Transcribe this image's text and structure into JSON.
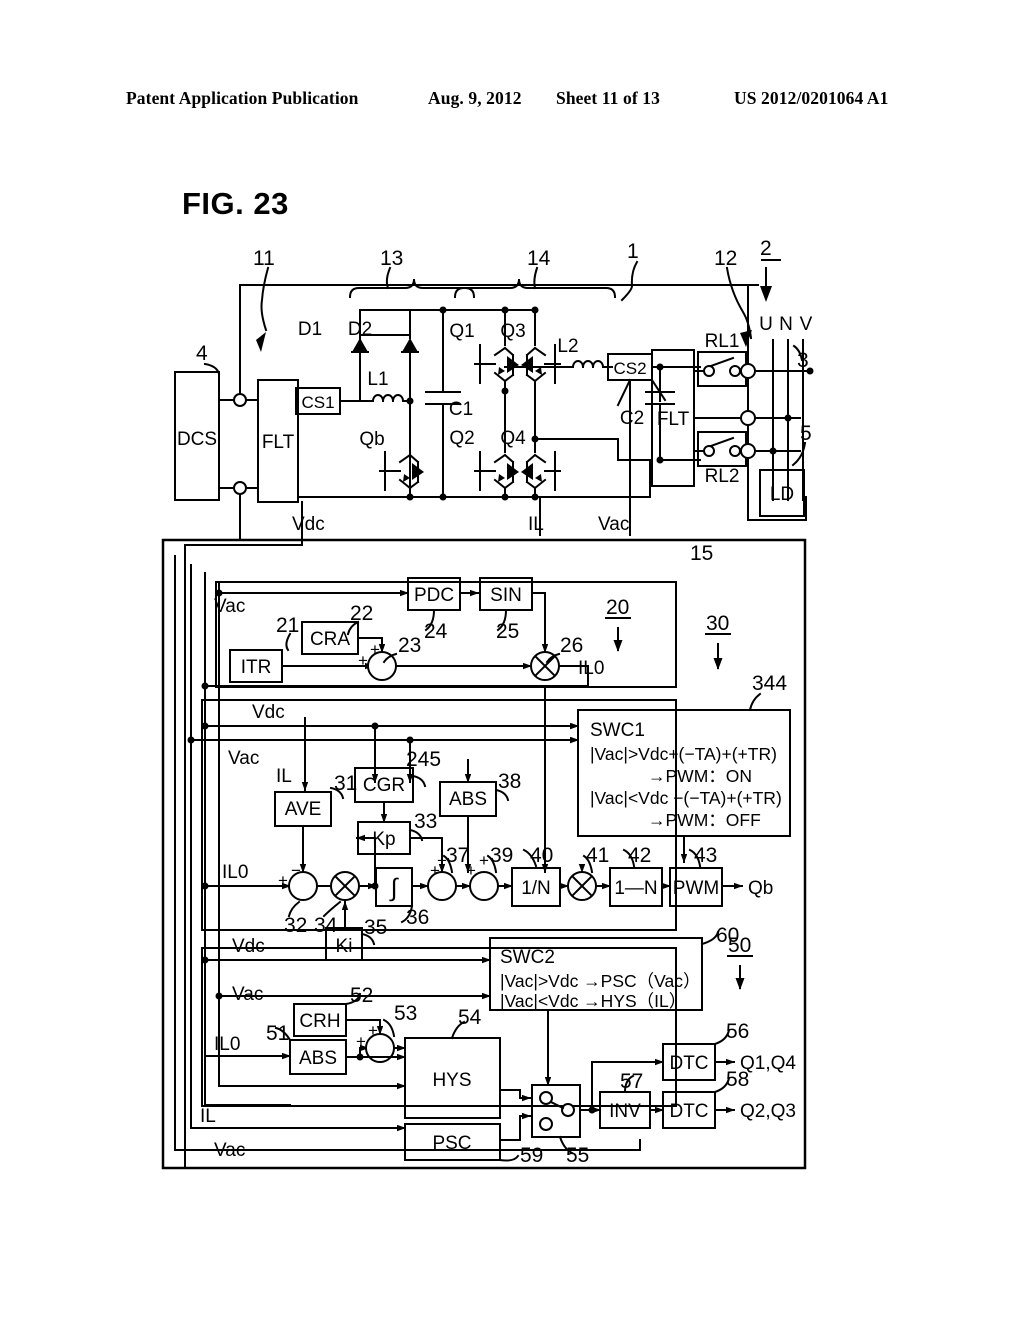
{
  "header": {
    "left": "Patent Application Publication",
    "date": "Aug. 9, 2012",
    "sheet": "Sheet 11 of 13",
    "pubnum": "US 2012/0201064 A1"
  },
  "figure": {
    "title": "FIG. 23"
  },
  "power_circuit": {
    "blocks": [
      {
        "id": "dcs",
        "label": "DCS"
      },
      {
        "id": "flt1",
        "label": "FLT"
      },
      {
        "id": "cs1",
        "label": "CS1"
      },
      {
        "id": "cs2",
        "label": "CS2"
      },
      {
        "id": "flt2",
        "label": "FLT"
      },
      {
        "id": "ld",
        "label": "LD"
      }
    ],
    "components": [
      {
        "id": "d1",
        "label": "D1"
      },
      {
        "id": "d2",
        "label": "D2"
      },
      {
        "id": "q1",
        "label": "Q1"
      },
      {
        "id": "q2",
        "label": "Q2"
      },
      {
        "id": "q3",
        "label": "Q3"
      },
      {
        "id": "q4",
        "label": "Q4"
      },
      {
        "id": "qb",
        "label": "Qb"
      },
      {
        "id": "l1",
        "label": "L1"
      },
      {
        "id": "l2",
        "label": "L2"
      },
      {
        "id": "c1",
        "label": "C1"
      },
      {
        "id": "c2",
        "label": "C2"
      },
      {
        "id": "rl1",
        "label": "RL1"
      },
      {
        "id": "rl2",
        "label": "RL2"
      }
    ],
    "terminals": {
      "u": "U",
      "n": "N",
      "v": "V"
    },
    "signals": {
      "vdc": "Vdc",
      "il": "IL",
      "vac": "Vac"
    },
    "refs": {
      "r1": "1",
      "r2": "2",
      "r3": "3",
      "r4": "4",
      "r5": "5",
      "r11": "11",
      "r12": "12",
      "r13": "13",
      "r14": "14"
    }
  },
  "control": {
    "refs": {
      "r15": "15",
      "r20": "20",
      "r21": "21",
      "r22": "22",
      "r23": "23",
      "r24": "24",
      "r25": "25",
      "r26": "26",
      "r30": "30",
      "r31": "31",
      "r32": "32",
      "r33": "33",
      "r34": "34",
      "r35": "35",
      "r36": "36",
      "r37": "37",
      "r38": "38",
      "r39": "39",
      "r40": "40",
      "r41": "41",
      "r42": "42",
      "r43": "43",
      "r50": "50",
      "r51": "51",
      "r52": "52",
      "r53": "53",
      "r54": "54",
      "r55": "55",
      "r56": "56",
      "r57": "57",
      "r58": "58",
      "r59": "59",
      "r60": "60",
      "r245": "245",
      "r344": "344"
    },
    "blocks": [
      {
        "id": "itr",
        "label": "ITR"
      },
      {
        "id": "cra",
        "label": "CRA"
      },
      {
        "id": "pdc",
        "label": "PDC"
      },
      {
        "id": "sin",
        "label": "SIN"
      },
      {
        "id": "ave",
        "label": "AVE"
      },
      {
        "id": "cgr",
        "label": "CGR"
      },
      {
        "id": "kp",
        "label": "Kp"
      },
      {
        "id": "ki",
        "label": "Ki"
      },
      {
        "id": "abs1",
        "label": "ABS"
      },
      {
        "id": "integ",
        "label": "∫"
      },
      {
        "id": "oneovern",
        "label": "1/N"
      },
      {
        "id": "oneminusn",
        "label": "1—N"
      },
      {
        "id": "pwm",
        "label": "PWM"
      },
      {
        "id": "crh",
        "label": "CRH"
      },
      {
        "id": "abs2",
        "label": "ABS"
      },
      {
        "id": "hys",
        "label": "HYS"
      },
      {
        "id": "psc",
        "label": "PSC"
      },
      {
        "id": "inv",
        "label": "INV"
      },
      {
        "id": "dtc1",
        "label": "DTC"
      },
      {
        "id": "dtc2",
        "label": "DTC"
      }
    ],
    "swc1": {
      "title": "SWC1",
      "line1": "|Vac|>Vdc+(−TA)+(+TR)",
      "line2": "→PWM：ON",
      "line3": "|Vac|<Vdc −(−TA)+(+TR)",
      "line4": "→PWM：OFF"
    },
    "swc2": {
      "title": "SWC2",
      "line1": "|Vac|>Vdc →PSC（Vac）",
      "line2": "|Vac|<Vdc →HYS（IL）"
    },
    "signals": {
      "vac": "Vac",
      "vdc": "Vdc",
      "il": "IL",
      "il0": "IL0"
    },
    "outputs": {
      "qb": "Qb",
      "q1q4": "Q1,Q4",
      "q2q3": "Q2,Q3"
    },
    "signs": {
      "plus": "+",
      "minus": "−"
    }
  }
}
